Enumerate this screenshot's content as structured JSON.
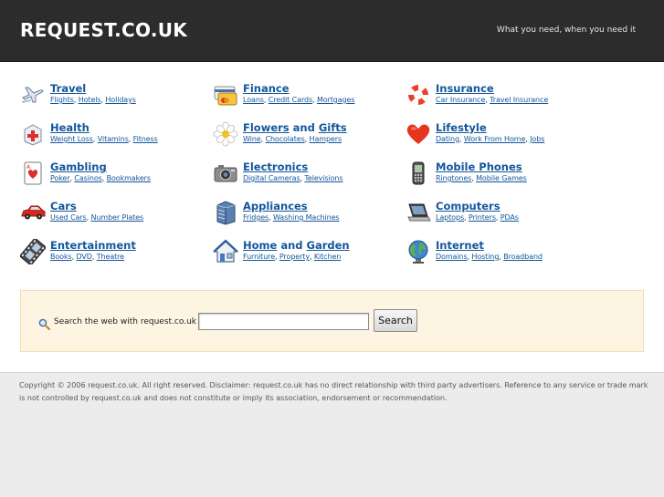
{
  "header": {
    "site_title": "REQUEST.CO.UK",
    "tagline": "What you need, when you need it"
  },
  "categories": [
    {
      "title": "Travel",
      "icon": "airplane-icon",
      "links": [
        "Flights",
        "Hotels",
        "Holidays"
      ]
    },
    {
      "title_a": "Finance",
      "icon": "credit-cards-icon",
      "links": [
        "Loans",
        "Credit Cards",
        "Mortgages"
      ]
    },
    {
      "title": "Insurance",
      "icon": "lifebuoy-icon",
      "links": [
        "Car Insurance",
        "Travel Insurance"
      ]
    },
    {
      "title": "Health",
      "icon": "first-aid-icon",
      "links": [
        "Weight Loss",
        "Vitamins",
        "Fitness"
      ]
    },
    {
      "title_a": "Flowers",
      "and": "and",
      "title_b": "Gifts",
      "icon": "flower-icon",
      "links": [
        "Wine",
        "Chocolates",
        "Hampers"
      ]
    },
    {
      "title": "Lifestyle",
      "icon": "heart-icon",
      "links": [
        "Dating",
        "Work From Home",
        "Jobs"
      ]
    },
    {
      "title": "Gambling",
      "icon": "playing-card-icon",
      "links": [
        "Poker",
        "Casinos",
        "Bookmakers"
      ]
    },
    {
      "title": "Electronics",
      "icon": "camera-icon",
      "links": [
        "Digital Cameras",
        "Televisions"
      ]
    },
    {
      "title": "Mobile Phones",
      "icon": "mobile-phone-icon",
      "links": [
        "Ringtones",
        "Mobile Games"
      ]
    },
    {
      "title": "Cars",
      "icon": "car-icon",
      "links": [
        "Used Cars",
        "Number Plates"
      ]
    },
    {
      "title": "Appliances",
      "icon": "appliance-icon",
      "links": [
        "Fridges",
        "Washing Machines"
      ]
    },
    {
      "title": "Computers",
      "icon": "laptop-icon",
      "links": [
        "Laptops",
        "Printers",
        "PDAs"
      ]
    },
    {
      "title": "Entertainment",
      "icon": "film-reel-icon",
      "links": [
        "Books",
        "DVD",
        "Theatre"
      ]
    },
    {
      "title_a": "Home",
      "and": "and",
      "title_b": "Garden",
      "icon": "house-icon",
      "links": [
        "Furniture",
        "Property",
        "Kitchen"
      ]
    },
    {
      "title": "Internet",
      "icon": "globe-icon",
      "links": [
        "Domains",
        "Hosting",
        "Broadband"
      ]
    }
  ],
  "search": {
    "label": "Search the web with request.co.uk",
    "value": "",
    "button_label": "Search"
  },
  "footer": {
    "text": "Copyright © 2006 request.co.uk. All right reserved. Disclaimer: request.co.uk has no direct relationship with third party advertisers. Reference to any service or trade mark is not controlled by request.co.uk and does not constitute or imply its association, endorsement or recommendation."
  },
  "colors": {
    "header_bg": "#2c2c2c",
    "link": "#14569c",
    "search_bg": "#fdf4e2",
    "footer_bg": "#ececec"
  }
}
